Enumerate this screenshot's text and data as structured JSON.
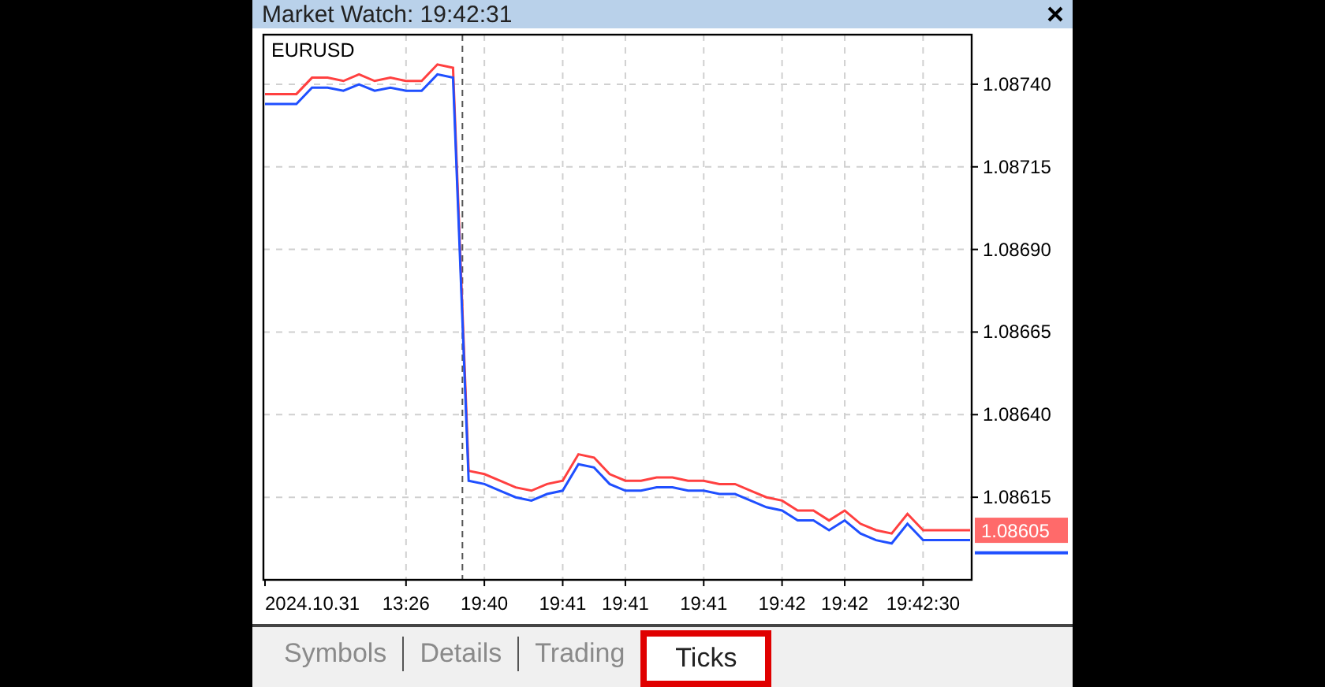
{
  "window": {
    "title": "Market Watch: 19:42:31"
  },
  "chart": {
    "symbol": "EURUSD",
    "current_price": "1.08605",
    "start_date": "2024.10.31",
    "chart_data": {
      "type": "line",
      "categories": [
        null,
        null,
        null,
        null,
        null,
        null,
        null,
        null,
        null,
        "13:26",
        null,
        null,
        null,
        null,
        "19:40",
        null,
        null,
        null,
        null,
        "19:41",
        null,
        null,
        null,
        "19:41",
        null,
        null,
        null,
        null,
        "19:41",
        null,
        null,
        null,
        null,
        "19:42",
        null,
        null,
        null,
        "19:42",
        null,
        null,
        null,
        null,
        "19:42:30",
        null,
        null,
        null
      ],
      "series": [
        {
          "color": "#ff4040",
          "values": [
            1.08737,
            1.08737,
            1.08737,
            1.08742,
            1.08742,
            1.08741,
            1.08743,
            1.08741,
            1.08742,
            1.08741,
            1.08741,
            1.08746,
            1.08745,
            1.08623,
            1.08622,
            1.0862,
            1.08618,
            1.08617,
            1.08619,
            1.0862,
            1.08628,
            1.08627,
            1.08622,
            1.0862,
            1.0862,
            1.08621,
            1.08621,
            1.0862,
            1.0862,
            1.08619,
            1.08619,
            1.08617,
            1.08615,
            1.08614,
            1.08611,
            1.08611,
            1.08608,
            1.08611,
            1.08607,
            1.08605,
            1.08604,
            1.0861,
            1.08605,
            1.08605,
            1.08605,
            1.08605
          ]
        },
        {
          "color": "#1f4fff",
          "values": [
            1.08734,
            1.08734,
            1.08734,
            1.08739,
            1.08739,
            1.08738,
            1.0874,
            1.08738,
            1.08739,
            1.08738,
            1.08738,
            1.08743,
            1.08742,
            1.0862,
            1.08619,
            1.08617,
            1.08615,
            1.08614,
            1.08616,
            1.08617,
            1.08625,
            1.08624,
            1.08619,
            1.08617,
            1.08617,
            1.08618,
            1.08618,
            1.08617,
            1.08617,
            1.08616,
            1.08616,
            1.08614,
            1.08612,
            1.08611,
            1.08608,
            1.08608,
            1.08605,
            1.08608,
            1.08604,
            1.08602,
            1.08601,
            1.08607,
            1.08602,
            1.08602,
            1.08602,
            1.08602
          ]
        }
      ],
      "grid": true,
      "ylim": [
        1.0859,
        1.08755
      ],
      "yticks": [
        {
          "value": 1.0874,
          "label": "1.08740"
        },
        {
          "value": 1.08715,
          "label": "1.08715"
        },
        {
          "value": 1.0869,
          "label": "1.08690"
        },
        {
          "value": 1.08665,
          "label": "1.08665"
        },
        {
          "value": 1.0864,
          "label": "1.08640"
        },
        {
          "value": 1.08615,
          "label": "1.08615"
        }
      ]
    }
  },
  "tabs": [
    {
      "label": "Symbols",
      "selected": false
    },
    {
      "label": "Details",
      "selected": false
    },
    {
      "label": "Trading",
      "selected": false
    },
    {
      "label": "Ticks",
      "selected": true
    }
  ]
}
